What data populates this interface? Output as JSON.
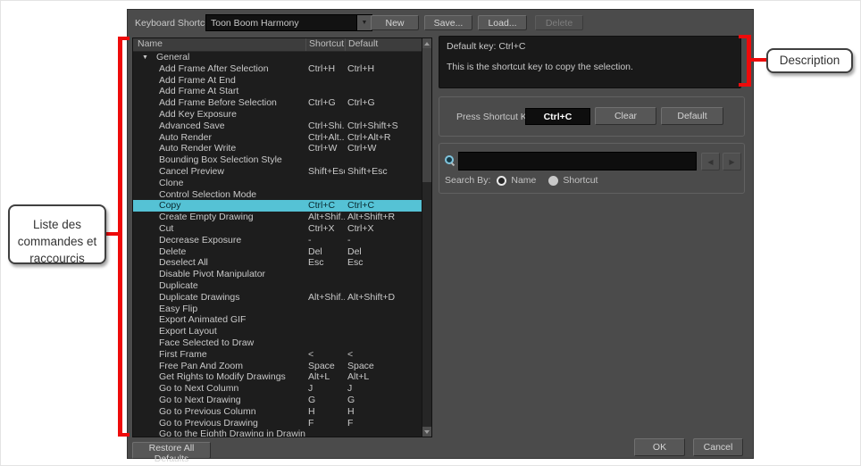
{
  "callouts": {
    "list": {
      "lines": [
        "Liste des",
        "commandes et",
        "raccourcis"
      ]
    },
    "description": {
      "label": "Description"
    }
  },
  "icons": {
    "caret_down": "▼",
    "category_expanded": "▼",
    "search_prev": "◀",
    "search_next": "▶"
  },
  "colors": {
    "selection_cyan": "#55c2d5",
    "annotation_red": "#ee0b0b",
    "dialog_background": "#4b4b4b"
  },
  "dialog": {
    "header": {
      "label": "Keyboard Shortcuts:",
      "preset": "Toon Boom Harmony",
      "new_label": "New",
      "save_label": "Save...",
      "load_label": "Load...",
      "delete_label": "Delete"
    },
    "list": {
      "columns": {
        "name": "Name",
        "shortcut": "Shortcut",
        "default": "Default"
      },
      "category": "General",
      "rows": [
        {
          "name": "Add Frame After Selection",
          "shortcut": "Ctrl+H",
          "default": "Ctrl+H"
        },
        {
          "name": "Add Frame At End",
          "shortcut": "",
          "default": ""
        },
        {
          "name": "Add Frame At Start",
          "shortcut": "",
          "default": ""
        },
        {
          "name": "Add Frame Before Selection",
          "shortcut": "Ctrl+G",
          "default": "Ctrl+G"
        },
        {
          "name": "Add Key Exposure",
          "shortcut": "",
          "default": ""
        },
        {
          "name": "Advanced Save",
          "shortcut": "Ctrl+Shi...",
          "default": "Ctrl+Shift+S"
        },
        {
          "name": "Auto Render",
          "shortcut": "Ctrl+Alt...",
          "default": "Ctrl+Alt+R"
        },
        {
          "name": "Auto Render Write",
          "shortcut": "Ctrl+W",
          "default": "Ctrl+W"
        },
        {
          "name": "Bounding Box Selection Style",
          "shortcut": "",
          "default": ""
        },
        {
          "name": "Cancel Preview",
          "shortcut": "Shift+Esc",
          "default": "Shift+Esc"
        },
        {
          "name": "Clone",
          "shortcut": "",
          "default": ""
        },
        {
          "name": "Control Selection Mode",
          "shortcut": "",
          "default": ""
        },
        {
          "name": "Copy",
          "shortcut": "Ctrl+C",
          "default": "Ctrl+C",
          "selected": true
        },
        {
          "name": "Create Empty Drawing",
          "shortcut": "Alt+Shif...",
          "default": "Alt+Shift+R"
        },
        {
          "name": "Cut",
          "shortcut": "Ctrl+X",
          "default": "Ctrl+X"
        },
        {
          "name": "Decrease Exposure",
          "shortcut": "-",
          "default": "-"
        },
        {
          "name": "Delete",
          "shortcut": "Del",
          "default": "Del"
        },
        {
          "name": "Deselect All",
          "shortcut": "Esc",
          "default": "Esc"
        },
        {
          "name": "Disable Pivot Manipulator",
          "shortcut": "",
          "default": ""
        },
        {
          "name": "Duplicate",
          "shortcut": "",
          "default": ""
        },
        {
          "name": "Duplicate Drawings",
          "shortcut": "Alt+Shif...",
          "default": "Alt+Shift+D"
        },
        {
          "name": "Easy Flip",
          "shortcut": "",
          "default": ""
        },
        {
          "name": "Export Animated GIF",
          "shortcut": "",
          "default": ""
        },
        {
          "name": "Export Layout",
          "shortcut": "",
          "default": ""
        },
        {
          "name": "Face Selected to Draw",
          "shortcut": "",
          "default": ""
        },
        {
          "name": "First Frame",
          "shortcut": "<",
          "default": "<"
        },
        {
          "name": "Free Pan And Zoom",
          "shortcut": "Space",
          "default": "Space"
        },
        {
          "name": "Get Rights to Modify Drawings",
          "shortcut": "Alt+L",
          "default": "Alt+L"
        },
        {
          "name": "Go to Next Column",
          "shortcut": "J",
          "default": "J"
        },
        {
          "name": "Go to Next Drawing",
          "shortcut": "G",
          "default": "G"
        },
        {
          "name": "Go to Previous Column",
          "shortcut": "H",
          "default": "H"
        },
        {
          "name": "Go to Previous Drawing",
          "shortcut": "F",
          "default": "F"
        },
        {
          "name": "Go to the Eighth Drawing in Drawing",
          "shortcut": "",
          "default": ""
        }
      ]
    },
    "description_panel": {
      "default_key": "Default key: Ctrl+C",
      "text": "This is the shortcut key to copy the selection."
    },
    "press_shortcut": {
      "label": "Press Shortcut Key:",
      "value": "Ctrl+C",
      "clear_label": "Clear",
      "default_label": "Default"
    },
    "search": {
      "value": "",
      "placeholder": "",
      "label": "Search By:",
      "options": [
        {
          "label": "Name",
          "selected": true
        },
        {
          "label": "Shortcut",
          "selected": false
        }
      ]
    },
    "footer": {
      "restore_label": "Restore All Defaults",
      "ok_label": "OK",
      "cancel_label": "Cancel"
    }
  }
}
